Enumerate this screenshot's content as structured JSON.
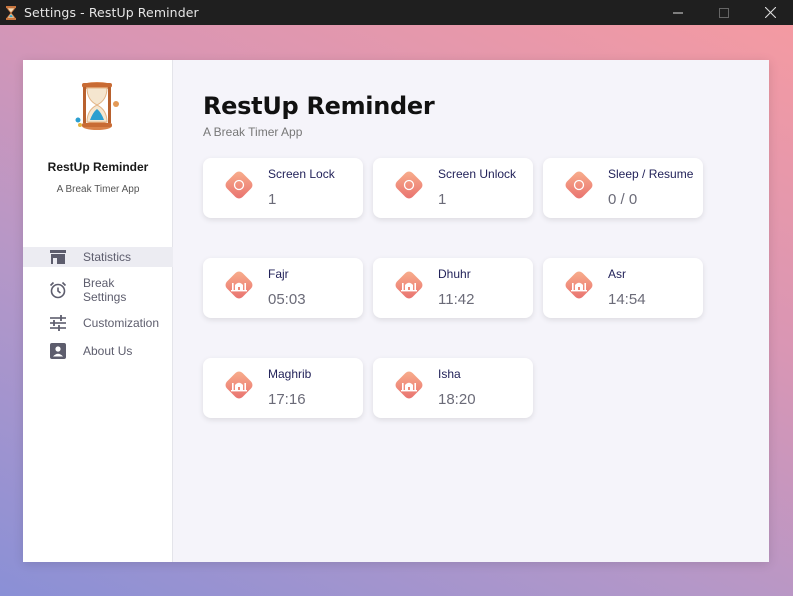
{
  "titlebar": {
    "title": "Settings - RestUp Reminder"
  },
  "sidebar": {
    "app_name": "RestUp Reminder",
    "app_subtitle": "A Break Timer App",
    "items": [
      {
        "label": "Statistics",
        "icon": "statistics-icon",
        "active": true
      },
      {
        "label": "Break\nSettings",
        "icon": "alarm-clock-icon",
        "active": false
      },
      {
        "label": "Customization",
        "icon": "sliders-icon",
        "active": false
      },
      {
        "label": "About Us",
        "icon": "contact-card-icon",
        "active": false
      }
    ]
  },
  "main": {
    "title": "RestUp Reminder",
    "subtitle": "A Break Timer App",
    "stats": [
      {
        "label": "Screen Lock",
        "value": "1",
        "icon": "circle-icon"
      },
      {
        "label": "Screen Unlock",
        "value": "1",
        "icon": "circle-icon"
      },
      {
        "label": "Sleep / Resume",
        "value": "0 / 0",
        "icon": "circle-icon"
      }
    ],
    "prayers": [
      {
        "label": "Fajr",
        "value": "05:03",
        "icon": "mosque-icon"
      },
      {
        "label": "Dhuhr",
        "value": "11:42",
        "icon": "mosque-icon"
      },
      {
        "label": "Asr",
        "value": "14:54",
        "icon": "mosque-icon"
      },
      {
        "label": "Maghrib",
        "value": "17:16",
        "icon": "mosque-icon"
      },
      {
        "label": "Isha",
        "value": "18:20",
        "icon": "mosque-icon"
      }
    ]
  },
  "colors": {
    "badge_gradient_start": "#f9a98a",
    "badge_gradient_end": "#e8736e",
    "card_label": "#23235a",
    "nav_active_bg": "#ececf2"
  }
}
